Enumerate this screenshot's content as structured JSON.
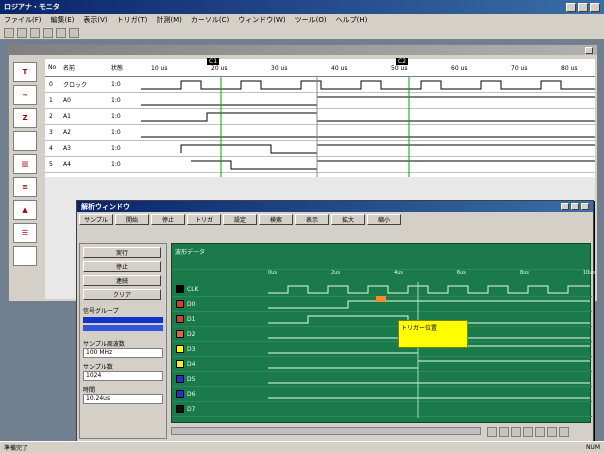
{
  "main_window": {
    "title": "ロジアナ・モニタ",
    "menus": [
      "ファイル(F)",
      "編集(E)",
      "表示(V)",
      "トリガ(T)",
      "計測(M)",
      "カーソル(C)",
      "ウィンドウ(W)",
      "ツール(O)",
      "ヘルプ(H)"
    ],
    "column_headers": [
      "No",
      "名前",
      "状態"
    ],
    "time_marks": [
      "10 us",
      "20 us",
      "30 us",
      "40 us",
      "50 us",
      "60 us",
      "70 us",
      "80 us"
    ],
    "cursor_labels": [
      "C1",
      "C2"
    ],
    "channels": [
      {
        "no": "0",
        "name": "クロック",
        "state": "1:0"
      },
      {
        "no": "1",
        "name": "A0",
        "state": "1:0"
      },
      {
        "no": "2",
        "name": "A1",
        "state": "1:0"
      },
      {
        "no": "3",
        "name": "A2",
        "state": "1:0"
      },
      {
        "no": "4",
        "name": "A3",
        "state": "1:0"
      },
      {
        "no": "5",
        "name": "A4",
        "state": "1:0"
      }
    ],
    "left_icons": [
      "trigger-icon",
      "wave-icon",
      "zoom-icon",
      "blank-icon",
      "chart-icon",
      "data-icon",
      "export-icon",
      "print-icon",
      "list-icon"
    ],
    "status_text": "準備完了",
    "status_right": "NUM"
  },
  "sub_window": {
    "title": "解析ウィンドウ",
    "toolbar_buttons": [
      "サンプル",
      "開始",
      "停止",
      "トリガ",
      "設定",
      "検索",
      "表示",
      "拡大",
      "縮小"
    ],
    "left_panel": {
      "buttons": [
        "実行",
        "停止",
        "連続",
        "クリア"
      ],
      "group_label": "信号グループ",
      "field1_label": "サンプル周波数",
      "field1_value": "100 MHz",
      "field2_label": "サンプル数",
      "field2_value": "1024",
      "field3_label": "時間",
      "field3_value": "10.24us"
    },
    "header_text": "波形データ",
    "signals": [
      {
        "name": "CLK",
        "color": "#000000"
      },
      {
        "name": "D0",
        "color": "#cc4422"
      },
      {
        "name": "D1",
        "color": "#cc4422"
      },
      {
        "name": "D2",
        "color": "#dd6633"
      },
      {
        "name": "D3",
        "color": "#ffff00"
      },
      {
        "name": "D4",
        "color": "#eeee22"
      },
      {
        "name": "D5",
        "color": "#2233cc"
      },
      {
        "name": "D6",
        "color": "#2233cc"
      },
      {
        "name": "D7",
        "color": "#111111"
      }
    ],
    "annotation": "トリガー位置",
    "time_ticks": [
      "0us",
      "2us",
      "4us",
      "6us",
      "8us",
      "10us"
    ]
  },
  "colors": {
    "accent": "#0a246a",
    "wave_bg": "#1a7a4a",
    "highlight": "#ffff00"
  }
}
